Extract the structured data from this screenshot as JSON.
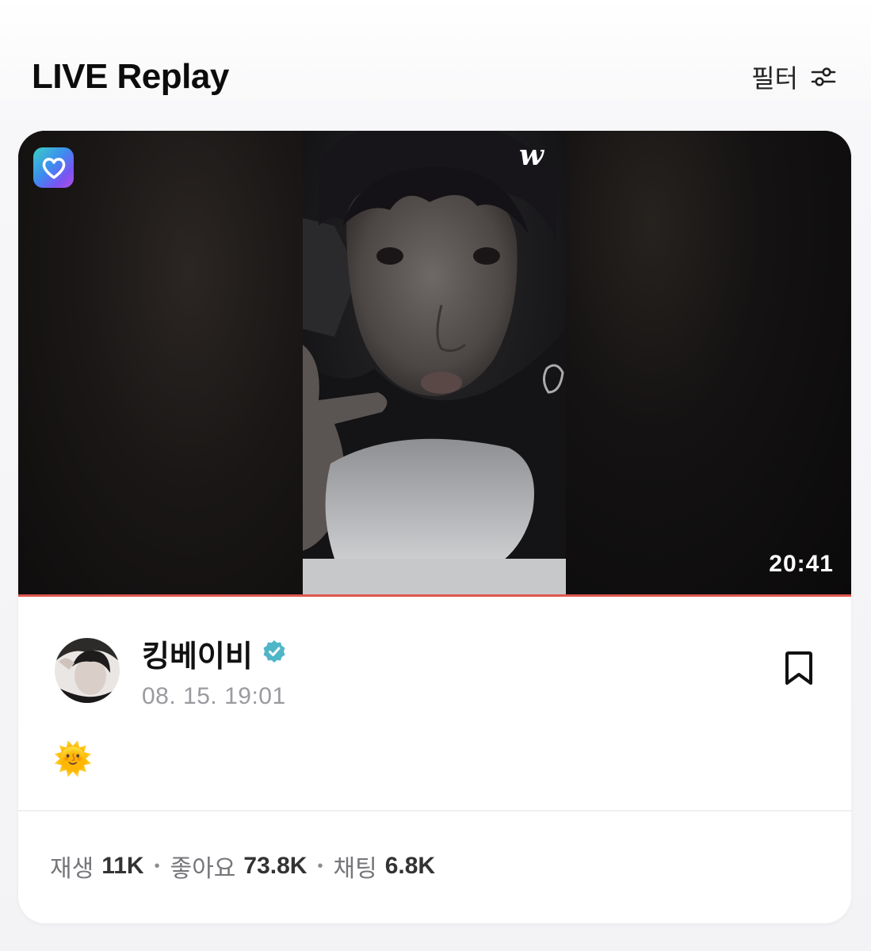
{
  "header": {
    "title": "LIVE Replay",
    "filter_label": "필터",
    "filter_icon": "sliders-icon"
  },
  "video": {
    "app_badge_icon": "heart-app-icon",
    "brand_logo": "w",
    "duration": "20:41",
    "progress": 1.0,
    "progress_color": "#e0564f"
  },
  "post": {
    "author": "킹베이비",
    "verified_icon": "verified-badge-icon",
    "verified_color": "#4fb6c8",
    "timestamp": "08. 15. 19:01",
    "caption": "🌞",
    "bookmark_icon": "bookmark-icon"
  },
  "stats": {
    "plays_label": "재생",
    "plays_value": "11K",
    "likes_label": "좋아요",
    "likes_value": "73.8K",
    "chats_label": "채팅",
    "chats_value": "6.8K",
    "separator": "•"
  }
}
